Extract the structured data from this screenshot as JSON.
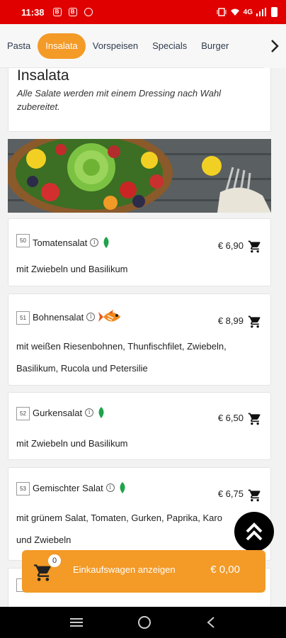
{
  "status_bar": {
    "time": "11:38",
    "icons": [
      "notification-icon",
      "notification-icon",
      "alarm-icon",
      "wifi-icon",
      "4g-signal-icon",
      "battery-icon"
    ],
    "network": "4G"
  },
  "tabs": [
    {
      "label": "Pasta",
      "active": false
    },
    {
      "label": "Insalata",
      "active": true
    },
    {
      "label": "Vorspeisen",
      "active": false
    },
    {
      "label": "Specials",
      "active": false
    },
    {
      "label": "Burger",
      "active": false
    }
  ],
  "section": {
    "title": "Insalata",
    "subtitle": "Alle Salate werden mit einem Dressing nach Wahl zubereitet."
  },
  "items": [
    {
      "number": "50",
      "name": "Tomatensalat",
      "badge": "leaf-icon",
      "price": "€ 6,90",
      "description": "mit Zwiebeln und Basilikum"
    },
    {
      "number": "51",
      "name": "Bohnensalat",
      "badge": "fish-icon",
      "price": "€ 8,99",
      "description_line1": "mit weißen Riesenbohnen, Thunfischfilet, Zwiebeln,",
      "description_line2": "Basilikum, Rucola und Petersilie"
    },
    {
      "number": "52",
      "name": "Gurkensalat",
      "badge": "leaf-icon",
      "price": "€ 6,50",
      "description": "mit Zwiebeln und Basilikum"
    },
    {
      "number": "53",
      "name": "Gemischter Salat",
      "badge": "leaf-icon",
      "price": "€ 6,75",
      "description_line1": "mit grünem Salat, Tomaten, Gurken, Paprika, Karo",
      "description_line2": "und Zwiebeln"
    }
  ],
  "cart": {
    "count": "0",
    "label": "Einkaufswagen anzeigen",
    "total": "€ 0,00"
  },
  "colors": {
    "status_bar": "#e00000",
    "accent": "#f39a27",
    "leaf": "#1fa34a"
  }
}
